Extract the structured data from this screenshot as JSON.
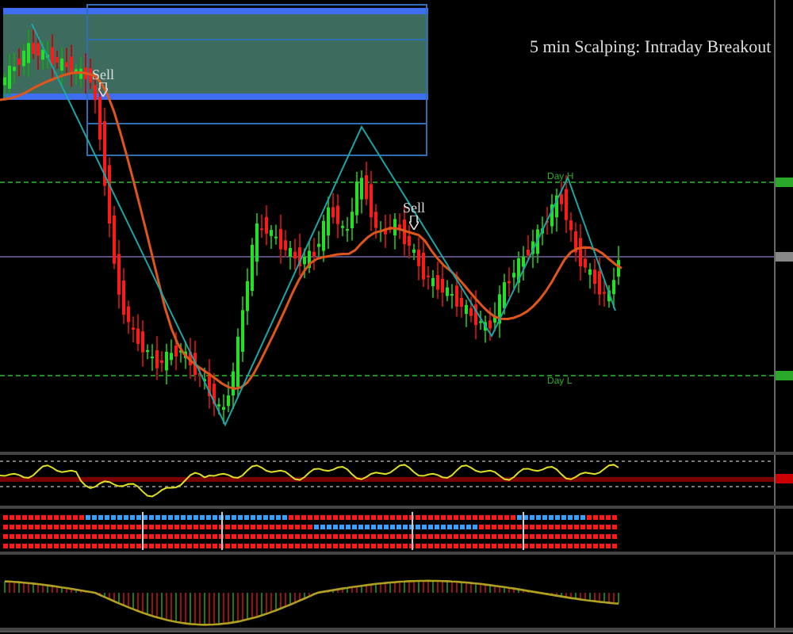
{
  "chart": {
    "title": "5 min Scalping: Intraday Breakout",
    "signals": [
      {
        "label": "Sell"
      },
      {
        "label": "Sell"
      }
    ],
    "levels": [
      {
        "label": "Day H"
      },
      {
        "label": "Day L"
      }
    ]
  }
}
